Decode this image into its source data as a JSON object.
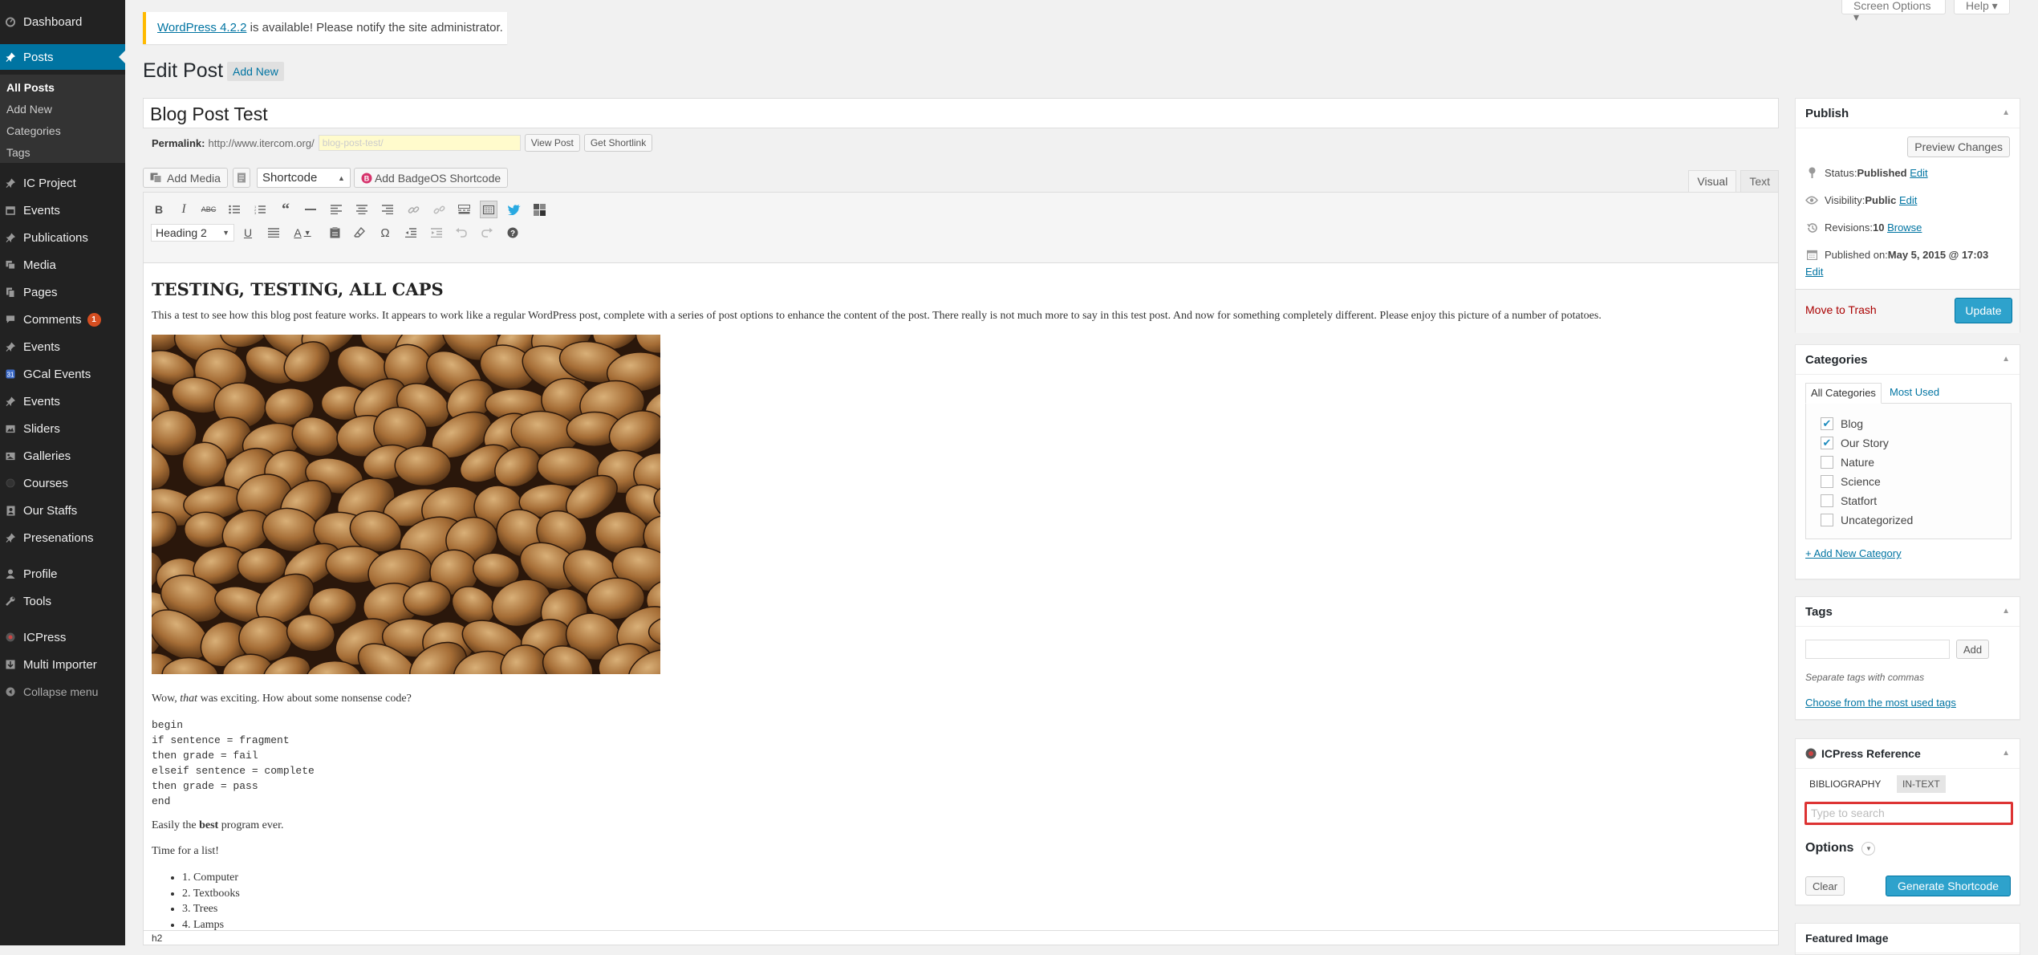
{
  "menu": {
    "dashboard": "Dashboard",
    "posts": "Posts",
    "posts_sub": [
      "All Posts",
      "Add New",
      "Categories",
      "Tags"
    ],
    "items": [
      "IC Project",
      "Events",
      "Publications",
      "Media",
      "Pages",
      "Comments",
      "Events",
      "GCal Events",
      "Events",
      "Sliders",
      "Galleries",
      "Courses",
      "Our Staffs",
      "Presenations",
      "Profile",
      "Tools",
      "ICPress",
      "Multi Importer"
    ],
    "comments_badge": "1",
    "collapse": "Collapse menu"
  },
  "notice": {
    "link": "WordPress 4.2.2",
    "text": " is available! Please notify the site administrator."
  },
  "topbar": {
    "screen_options": "Screen Options ▾",
    "help": "Help ▾"
  },
  "header": {
    "title": "Edit Post",
    "add_new": "Add New"
  },
  "post": {
    "title": "Blog Post Test",
    "permalink_label": "Permalink:",
    "permalink_url": "http://www.itercom.org/",
    "slug": "blog-post-test/",
    "view_post": "View Post",
    "get_shortlink": "Get Shortlink"
  },
  "editor": {
    "add_media": "Add Media",
    "shortcode": "Shortcode",
    "badgeos": "Add BadgeOS Shortcode",
    "tab_visual": "Visual",
    "tab_text": "Text",
    "format": "Heading 2",
    "status_path": "h2"
  },
  "content": {
    "heading": "TESTING, TESTING, ALL CAPS",
    "para1": "This a test to see how this blog post feature works. It appears to work like a regular WordPress post, complete with a series of post options to enhance the content of the post. There really is not much more to say in this test post. And now for something completely different. Please enjoy this picture of a number of potatoes.",
    "wow_pre": "Wow, ",
    "wow_em": "that",
    "wow_post": " was exciting. How about some nonsense code?",
    "code": "begin\nif sentence = fragment\nthen grade = fail\nelseif sentence = complete\nthen grade = pass\nend",
    "easily_pre": "Easily the ",
    "easily_b": "best",
    "easily_post": " program ever.",
    "time": "Time for a list!",
    "list": [
      "1. Computer",
      "2. Textbooks",
      "3. Trees",
      "4. Lamps"
    ]
  },
  "publish": {
    "title": "Publish",
    "preview": "Preview Changes",
    "status_label": "Status: ",
    "status": "Published",
    "visibility_label": "Visibility: ",
    "visibility": "Public",
    "revisions_label": "Revisions: ",
    "revisions": "10",
    "browse": "Browse",
    "published_label": "Published on: ",
    "published_on": "May 5, 2015 @ 17:03",
    "edit": "Edit",
    "trash": "Move to Trash",
    "update": "Update"
  },
  "categories": {
    "title": "Categories",
    "tab_all": "All Categories",
    "tab_most": "Most Used",
    "items": [
      {
        "label": "Blog",
        "checked": true
      },
      {
        "label": "Our Story",
        "checked": true
      },
      {
        "label": "Nature",
        "checked": false
      },
      {
        "label": "Science",
        "checked": false
      },
      {
        "label": "Statfort",
        "checked": false
      },
      {
        "label": "Uncategorized",
        "checked": false
      }
    ],
    "add_new": "+ Add New Category"
  },
  "tags": {
    "title": "Tags",
    "add": "Add",
    "hint": "Separate tags with commas",
    "choose": "Choose from the most used tags"
  },
  "icpress": {
    "title": "ICPress Reference",
    "tab_bib": "BIBLIOGRAPHY",
    "tab_intext": "IN-TEXT",
    "search_placeholder": "Type to search",
    "options": "Options",
    "clear": "Clear",
    "generate": "Generate Shortcode"
  },
  "featured": {
    "title": "Featured Image"
  },
  "colors": {
    "accent": "#0074a2",
    "sidebar": "#222222",
    "button": "#2ea2cc",
    "trash": "#a00000",
    "highlight": "#dd3333"
  }
}
